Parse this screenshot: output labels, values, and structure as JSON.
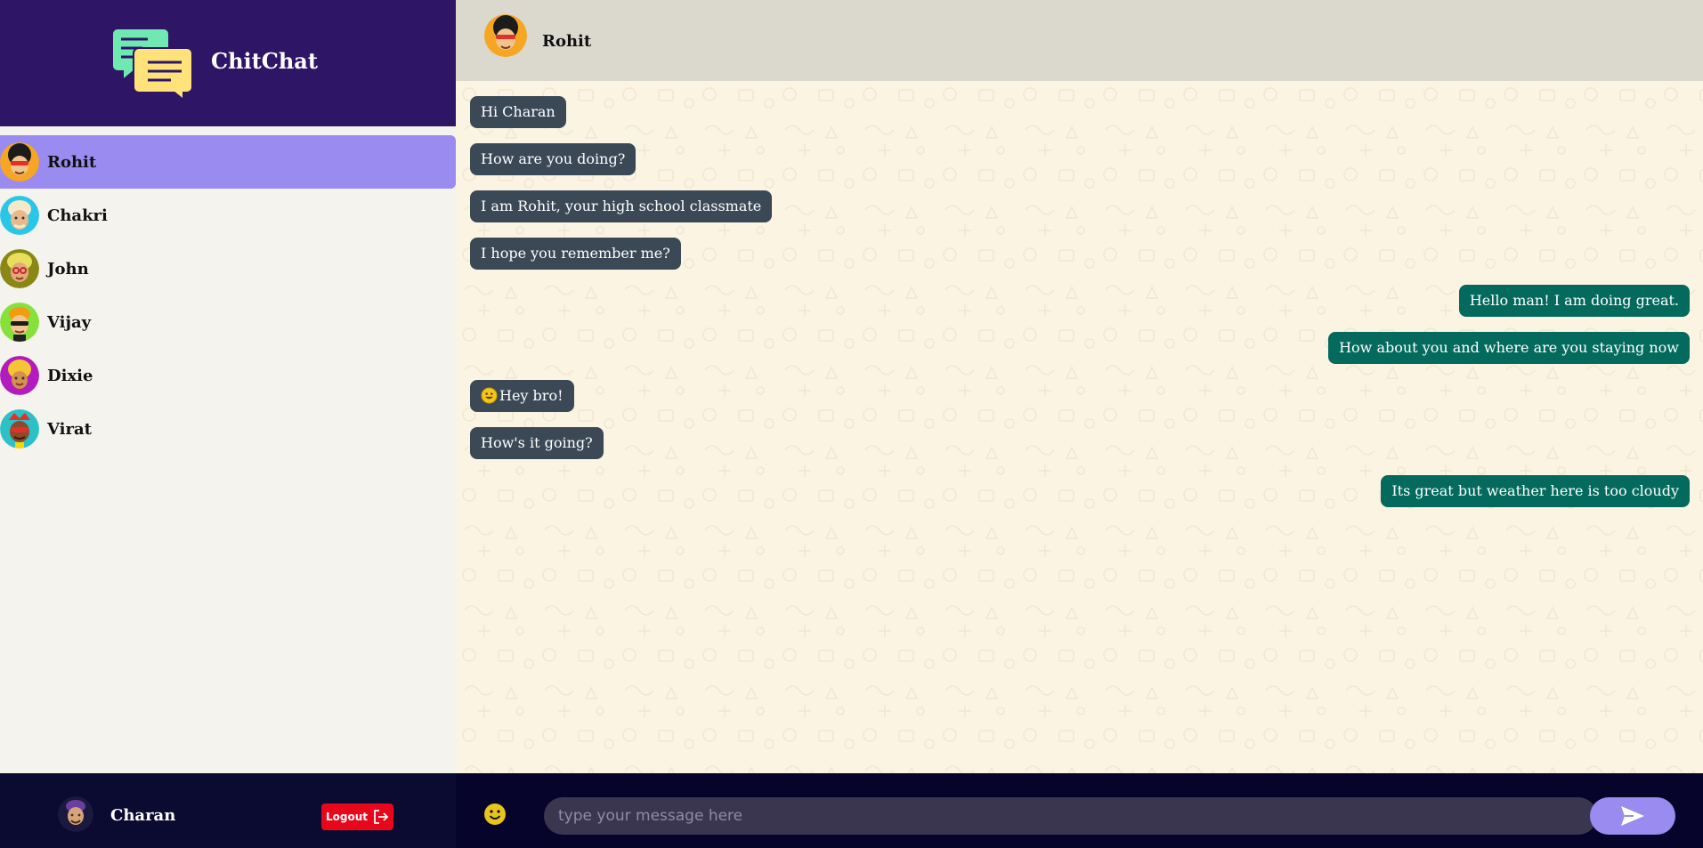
{
  "app": {
    "title": "ChitChat",
    "brand_color": "#2e1565",
    "accent_color": "#9a8bf1"
  },
  "sidebar": {
    "contacts": [
      {
        "name": "Rohit",
        "active": true
      },
      {
        "name": "Chakri",
        "active": false
      },
      {
        "name": "John",
        "active": false
      },
      {
        "name": "Vijay",
        "active": false
      },
      {
        "name": "Dixie",
        "active": false
      },
      {
        "name": "Virat",
        "active": false
      }
    ]
  },
  "current_user": {
    "name": "Charan",
    "logout_label": "Logout",
    "logout_color": "#e8071a"
  },
  "chat": {
    "contact_name": "Rohit",
    "messages": [
      {
        "direction": "in",
        "text": "Hi Charan"
      },
      {
        "direction": "in",
        "text": "How are you doing?"
      },
      {
        "direction": "in",
        "text": "I am Rohit, your high school classmate"
      },
      {
        "direction": "in",
        "text": "I hope you remember me?"
      },
      {
        "direction": "out",
        "text": "Hello man! I am doing great."
      },
      {
        "direction": "out",
        "text": "How about you and where are you staying now"
      },
      {
        "direction": "in",
        "text": "Hey bro!",
        "emoji": "smiley-emoji"
      },
      {
        "direction": "in",
        "text": "How's it going?"
      },
      {
        "direction": "out",
        "text": "Its great but weather here is too cloudy"
      }
    ],
    "incoming_color": "#3b4956",
    "outgoing_color": "#036a5d"
  },
  "composer": {
    "placeholder": "type your message here",
    "emoji_icon": "smiley-icon",
    "send_icon": "send-icon"
  }
}
